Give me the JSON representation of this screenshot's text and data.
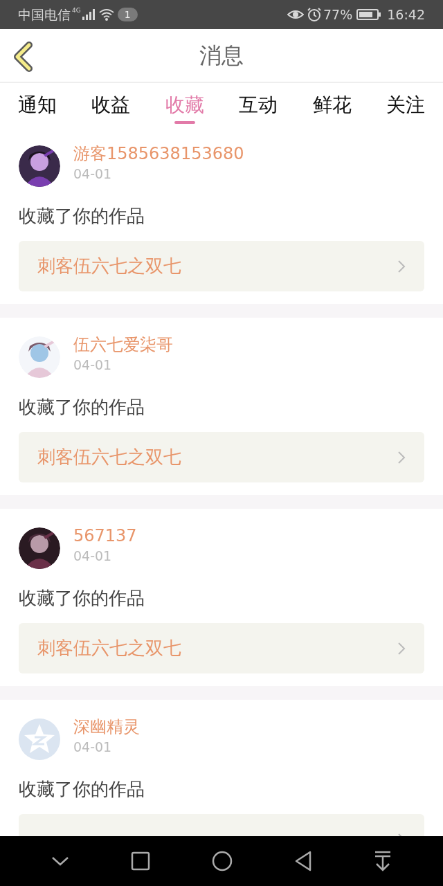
{
  "status_bar": {
    "carrier": "中国电信",
    "network_type": "4G",
    "notification_count": "1",
    "battery_percent": "77%",
    "time": "16:42"
  },
  "header": {
    "title": "消息"
  },
  "tabs": [
    {
      "label": "通知",
      "selected": false
    },
    {
      "label": "收益",
      "selected": false
    },
    {
      "label": "收藏",
      "selected": true
    },
    {
      "label": "互动",
      "selected": false
    },
    {
      "label": "鲜花",
      "selected": false
    },
    {
      "label": "关注",
      "selected": false
    }
  ],
  "messages": [
    {
      "user": "游客1585638153680",
      "date": "04-01",
      "action": "收藏了你的作品",
      "work": "刺客伍六七之双七"
    },
    {
      "user": "伍六七爱柒哥",
      "date": "04-01",
      "action": "收藏了你的作品",
      "work": "刺客伍六七之双七"
    },
    {
      "user": "567137",
      "date": "04-01",
      "action": "收藏了你的作品",
      "work": "刺客伍六七之双七"
    },
    {
      "avatar": {
        "kind": "default"
      },
      "user": "深幽精灵",
      "date": "04-01",
      "action": "收藏了你的作品"
    }
  ]
}
